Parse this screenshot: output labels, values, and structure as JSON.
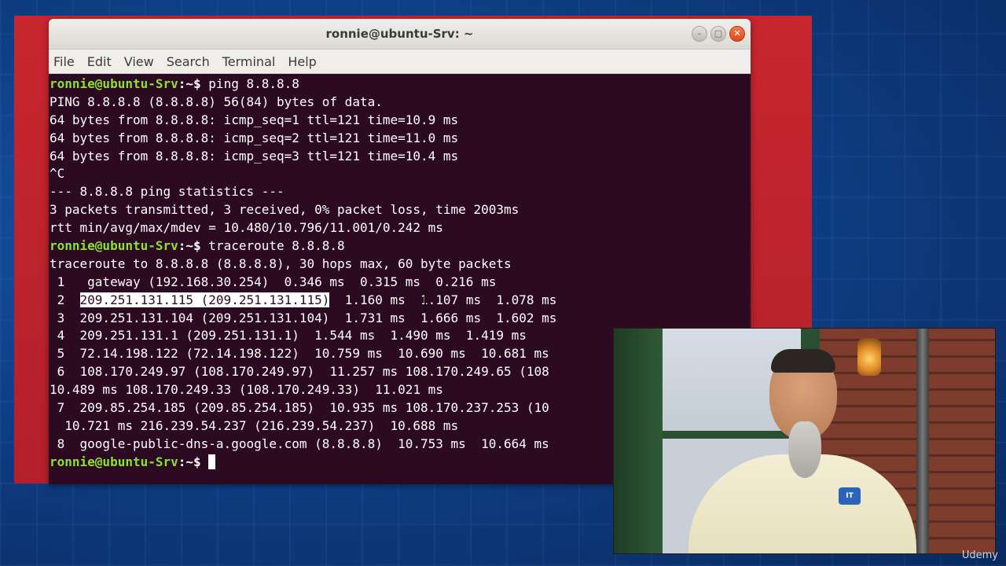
{
  "window": {
    "title": "ronnie@ubuntu-Srv: ~",
    "minimize_symbol": "–",
    "maximize_symbol": "□",
    "close_symbol": "✕"
  },
  "menu": [
    "File",
    "Edit",
    "View",
    "Search",
    "Terminal",
    "Help"
  ],
  "terminal": {
    "prompt": "ronnie@ubuntu-Srv",
    "prompt_suffix": ":~$ ",
    "lines": [
      {
        "prompt": true,
        "text": "ping 8.8.8.8"
      },
      {
        "text": "PING 8.8.8.8 (8.8.8.8) 56(84) bytes of data."
      },
      {
        "text": "64 bytes from 8.8.8.8: icmp_seq=1 ttl=121 time=10.9 ms"
      },
      {
        "text": "64 bytes from 8.8.8.8: icmp_seq=2 ttl=121 time=11.0 ms"
      },
      {
        "text": "64 bytes from 8.8.8.8: icmp_seq=3 ttl=121 time=10.4 ms"
      },
      {
        "text": "^C"
      },
      {
        "text": "--- 8.8.8.8 ping statistics ---"
      },
      {
        "text": "3 packets transmitted, 3 received, 0% packet loss, time 2003ms"
      },
      {
        "text": "rtt min/avg/max/mdev = 10.480/10.796/11.001/0.242 ms"
      },
      {
        "prompt": true,
        "text": "traceroute 8.8.8.8"
      },
      {
        "text": "traceroute to 8.8.8.8 (8.8.8.8), 30 hops max, 60 byte packets"
      },
      {
        "text": " 1   gateway (192.168.30.254)  0.346 ms  0.315 ms  0.216 ms"
      },
      {
        "pre": " 2  ",
        "selected": "209.251.131.115 (209.251.131.115)",
        "text": "  1.160 ms  1.107 ms  1.078 ms"
      },
      {
        "text": " 3  209.251.131.104 (209.251.131.104)  1.731 ms  1.666 ms  1.602 ms"
      },
      {
        "text": " 4  209.251.131.1 (209.251.131.1)  1.544 ms  1.490 ms  1.419 ms"
      },
      {
        "text": " 5  72.14.198.122 (72.14.198.122)  10.759 ms  10.690 ms  10.681 ms"
      },
      {
        "text": " 6  108.170.249.97 (108.170.249.97)  11.257 ms 108.170.249.65 (108"
      },
      {
        "text": "10.489 ms 108.170.249.33 (108.170.249.33)  11.021 ms"
      },
      {
        "text": " 7  209.85.254.185 (209.85.254.185)  10.935 ms 108.170.237.253 (10"
      },
      {
        "text": "  10.721 ms 216.239.54.237 (216.239.54.237)  10.688 ms"
      },
      {
        "text": " 8  google-public-dns-a.google.com (8.8.8.8)  10.753 ms  10.664 ms"
      },
      {
        "prompt": true,
        "text": "",
        "cursor": true
      }
    ]
  },
  "video": {
    "logo_text": "IT"
  },
  "watermark": "Udemy",
  "colors": {
    "terminal_bg": "#2c0a21",
    "prompt_green": "#8ae234",
    "desktop_red": "#c7262f",
    "background_blue": "#0f3f86"
  }
}
